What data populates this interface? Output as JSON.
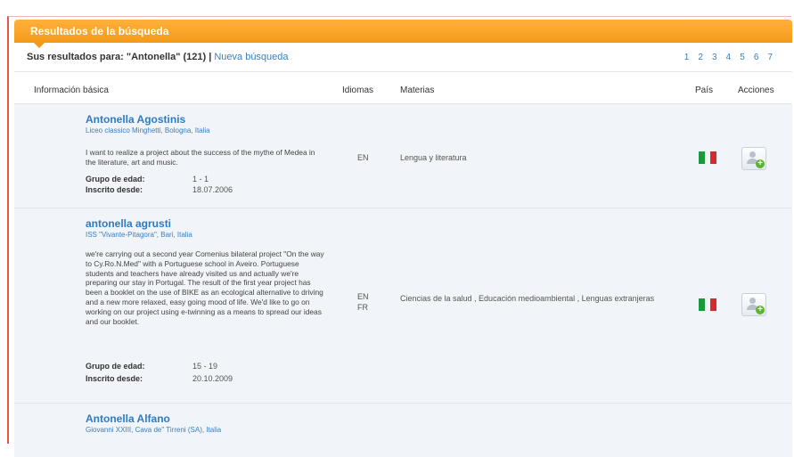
{
  "header": {
    "title": "Resultados de la búsqueda"
  },
  "summary": {
    "text": "Sus resultados para: \"Antonella\" (121) | ",
    "new_search": "Nueva búsqueda"
  },
  "pagination": [
    "1",
    "2",
    "3",
    "4",
    "5",
    "6",
    "7"
  ],
  "columns": {
    "info": "Información básica",
    "idiomas": "Idiomas",
    "materias": "Materias",
    "pais": "País",
    "acciones": "Acciones"
  },
  "labels": {
    "age_group": "Grupo de edad:",
    "registered": "Inscrito desde:"
  },
  "results": [
    {
      "name": "Antonella Agostinis",
      "school": "Liceo classico Minghetti, Bologna, Italia",
      "description": "I want to realize a project about the success of the mythe of Medea in the literature, art and music.",
      "age_group": "1 - 1",
      "registered": "18.07.2006",
      "languages": [
        "EN"
      ],
      "subjects": "Lengua y literatura",
      "country_flag": "italy-flag"
    },
    {
      "name": "antonella agrusti",
      "school": "ISS \"Vivante-Pitagora\", Bari, Italia",
      "description": "we're carrying out a second year Comenius bilateral project \"On the way to Cy.Ro.N.Med\" with a Portuguese school in Aveiro. Portuguese students and teachers have already visited us and actually we're preparing our stay in Portugal. The result of the first year project has been a booklet on the use of BIKE as an ecological alternative to driving and a new more relaxed, easy going mood of life. We'd like to go on working on our project using e-twinning as a means to spread our ideas and our booklet.",
      "age_group": "15 - 19",
      "registered": "20.10.2009",
      "languages": [
        "EN",
        "FR"
      ],
      "subjects": "Ciencias de la salud , Educación medioambiental , Lenguas extranjeras",
      "country_flag": "italy-flag"
    },
    {
      "name": "Antonella Alfano",
      "school": "Giovanni XXIII, Cava de\" Tirreni (SA), Italia"
    }
  ],
  "colors": {
    "accent_orange": "#f49a1a",
    "link_blue": "#2f7bc2",
    "row_bg": "#f1f4f8"
  },
  "icons": {
    "action": "add-contact-icon"
  }
}
